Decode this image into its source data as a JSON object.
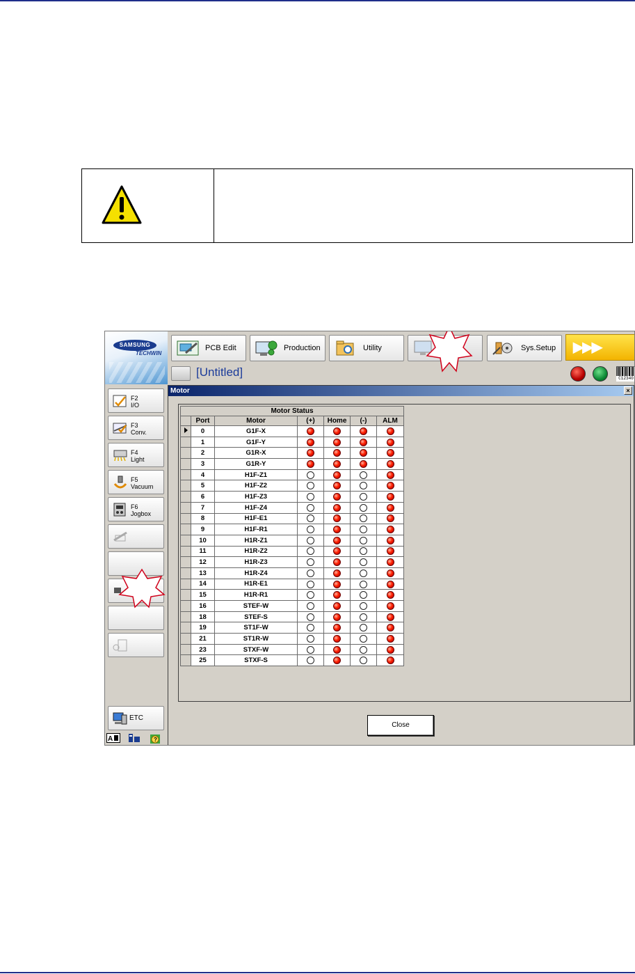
{
  "app": {
    "logo": {
      "brand": "SAMSUNG",
      "sub": "TECHWIN"
    },
    "top_buttons": [
      {
        "label": "PCB Edit",
        "icon": "pcb-edit-icon"
      },
      {
        "label": "Production",
        "icon": "production-icon"
      },
      {
        "label": "Utility",
        "icon": "utility-icon"
      },
      {
        "label": "",
        "icon": "monitor-icon",
        "disabled": true
      },
      {
        "label": "Sys.Setup",
        "icon": "sys-setup-icon"
      }
    ],
    "arrow_button": "▶▶▶",
    "document_title": "[Untitled]",
    "barcode_text": "C12340",
    "side_buttons": [
      {
        "key": "F2",
        "label": "I/O",
        "icon": "io-icon"
      },
      {
        "key": "F3",
        "label": "Conv.",
        "icon": "conveyor-icon"
      },
      {
        "key": "F4",
        "label": "Light",
        "icon": "light-icon"
      },
      {
        "key": "F5",
        "label": "Vacuum",
        "icon": "vacuum-icon"
      },
      {
        "key": "F6",
        "label": "Jogbox",
        "icon": "jogbox-icon"
      }
    ],
    "etc_label": "ETC",
    "status_colors": {
      "on": "#ff2000",
      "off": "#ffffff",
      "lamp_red": "#b80000",
      "lamp_green": "#0d8a35",
      "accent_yellow": "#f3b400"
    }
  },
  "dialog": {
    "title": "Motor",
    "close_glyph": "×",
    "panel_title": "Motor Status",
    "columns": [
      "Port",
      "Motor",
      "(+)",
      "Home",
      "(-)",
      "ALM"
    ],
    "rows": [
      {
        "port": "0",
        "motor": "G1F-X",
        "plus": true,
        "home": true,
        "minus": true,
        "alm": true
      },
      {
        "port": "1",
        "motor": "G1F-Y",
        "plus": true,
        "home": true,
        "minus": true,
        "alm": true
      },
      {
        "port": "2",
        "motor": "G1R-X",
        "plus": true,
        "home": true,
        "minus": true,
        "alm": true
      },
      {
        "port": "3",
        "motor": "G1R-Y",
        "plus": true,
        "home": true,
        "minus": true,
        "alm": true
      },
      {
        "port": "4",
        "motor": "H1F-Z1",
        "plus": false,
        "home": true,
        "minus": false,
        "alm": true
      },
      {
        "port": "5",
        "motor": "H1F-Z2",
        "plus": false,
        "home": true,
        "minus": false,
        "alm": true
      },
      {
        "port": "6",
        "motor": "H1F-Z3",
        "plus": false,
        "home": true,
        "minus": false,
        "alm": true
      },
      {
        "port": "7",
        "motor": "H1F-Z4",
        "plus": false,
        "home": true,
        "minus": false,
        "alm": true
      },
      {
        "port": "8",
        "motor": "H1F-E1",
        "plus": false,
        "home": true,
        "minus": false,
        "alm": true
      },
      {
        "port": "9",
        "motor": "H1F-R1",
        "plus": false,
        "home": true,
        "minus": false,
        "alm": true
      },
      {
        "port": "10",
        "motor": "H1R-Z1",
        "plus": false,
        "home": true,
        "minus": false,
        "alm": true
      },
      {
        "port": "11",
        "motor": "H1R-Z2",
        "plus": false,
        "home": true,
        "minus": false,
        "alm": true
      },
      {
        "port": "12",
        "motor": "H1R-Z3",
        "plus": false,
        "home": true,
        "minus": false,
        "alm": true
      },
      {
        "port": "13",
        "motor": "H1R-Z4",
        "plus": false,
        "home": true,
        "minus": false,
        "alm": true
      },
      {
        "port": "14",
        "motor": "H1R-E1",
        "plus": false,
        "home": true,
        "minus": false,
        "alm": true
      },
      {
        "port": "15",
        "motor": "H1R-R1",
        "plus": false,
        "home": true,
        "minus": false,
        "alm": true
      },
      {
        "port": "16",
        "motor": "STEF-W",
        "plus": false,
        "home": true,
        "minus": false,
        "alm": true
      },
      {
        "port": "18",
        "motor": "STEF-S",
        "plus": false,
        "home": true,
        "minus": false,
        "alm": true
      },
      {
        "port": "19",
        "motor": "ST1F-W",
        "plus": false,
        "home": true,
        "minus": false,
        "alm": true
      },
      {
        "port": "21",
        "motor": "ST1R-W",
        "plus": false,
        "home": true,
        "minus": false,
        "alm": true
      },
      {
        "port": "23",
        "motor": "STXF-W",
        "plus": false,
        "home": true,
        "minus": false,
        "alm": true
      },
      {
        "port": "25",
        "motor": "STXF-S",
        "plus": false,
        "home": true,
        "minus": false,
        "alm": true
      }
    ],
    "close_label": "Close"
  }
}
